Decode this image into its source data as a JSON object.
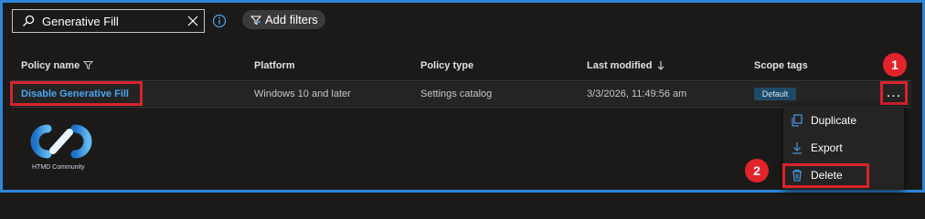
{
  "search": {
    "value": "Generative Fill"
  },
  "toolbar": {
    "add_filters_label": "Add filters"
  },
  "table": {
    "columns": [
      "Policy name",
      "Platform",
      "Policy type",
      "Last modified",
      "Scope tags"
    ],
    "rows": [
      {
        "policy_name": "Disable Generative Fill",
        "platform": "Windows 10 and later",
        "policy_type": "Settings catalog",
        "last_modified": "3/3/2026, 11:49:56 am",
        "scope_tag": "Default"
      }
    ]
  },
  "row_actions": {
    "more_label": "..."
  },
  "context_menu": {
    "items": [
      {
        "label": "Duplicate",
        "icon": "duplicate-icon"
      },
      {
        "label": "Export",
        "icon": "export-icon"
      },
      {
        "label": "Delete",
        "icon": "delete-icon"
      }
    ]
  },
  "annotations": {
    "callout_1": "1",
    "callout_2": "2"
  },
  "logo": {
    "text": "HTMD Community"
  },
  "colors": {
    "accent": "#2f86d8",
    "link": "#4ba4f2",
    "highlight": "#d9232e",
    "background": "#1b1a19"
  }
}
